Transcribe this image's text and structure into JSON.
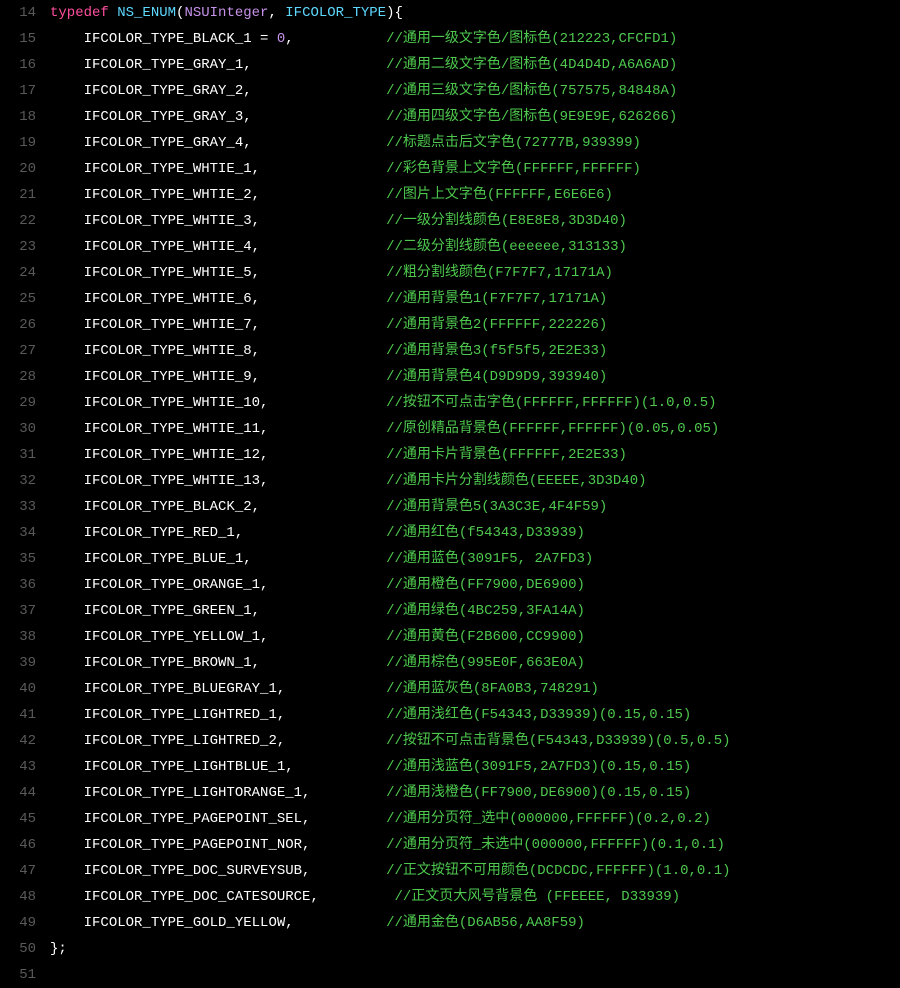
{
  "header": {
    "line_no": "14",
    "typedef": "typedef",
    "nsenum": "NS_ENUM",
    "uint": "NSUInteger",
    "enum_name": "IFCOLOR_TYPE",
    "open": "){"
  },
  "rows": [
    {
      "ln": "15",
      "name": "IFCOLOR_TYPE_BLACK_1 = ",
      "num": "0",
      "tail": ",",
      "comment": "//通用一级文字色/图标色(212223,CFCFD1)"
    },
    {
      "ln": "16",
      "name": "IFCOLOR_TYPE_GRAY_1,",
      "comment": "//通用二级文字色/图标色(4D4D4D,A6A6AD)"
    },
    {
      "ln": "17",
      "name": "IFCOLOR_TYPE_GRAY_2,",
      "comment": "//通用三级文字色/图标色(757575,84848A)"
    },
    {
      "ln": "18",
      "name": "IFCOLOR_TYPE_GRAY_3,",
      "comment": "//通用四级文字色/图标色(9E9E9E,626266)"
    },
    {
      "ln": "19",
      "name": "IFCOLOR_TYPE_GRAY_4,",
      "comment": "//标题点击后文字色(72777B,939399)"
    },
    {
      "ln": "20",
      "name": "IFCOLOR_TYPE_WHTIE_1,",
      "comment": "//彩色背景上文字色(FFFFFF,FFFFFF)"
    },
    {
      "ln": "21",
      "name": "IFCOLOR_TYPE_WHTIE_2,",
      "comment": "//图片上文字色(FFFFFF,E6E6E6)"
    },
    {
      "ln": "22",
      "name": "IFCOLOR_TYPE_WHTIE_3,",
      "comment": "//一级分割线颜色(E8E8E8,3D3D40)"
    },
    {
      "ln": "23",
      "name": "IFCOLOR_TYPE_WHTIE_4,",
      "comment": "//二级分割线颜色(eeeeee,313133)"
    },
    {
      "ln": "24",
      "name": "IFCOLOR_TYPE_WHTIE_5,",
      "comment": "//粗分割线颜色(F7F7F7,17171A)"
    },
    {
      "ln": "25",
      "name": "IFCOLOR_TYPE_WHTIE_6,",
      "comment": "//通用背景色1(F7F7F7,17171A)"
    },
    {
      "ln": "26",
      "name": "IFCOLOR_TYPE_WHTIE_7,",
      "comment": "//通用背景色2(FFFFFF,222226)"
    },
    {
      "ln": "27",
      "name": "IFCOLOR_TYPE_WHTIE_8,",
      "comment": "//通用背景色3(f5f5f5,2E2E33)"
    },
    {
      "ln": "28",
      "name": "IFCOLOR_TYPE_WHTIE_9,",
      "comment": "//通用背景色4(D9D9D9,393940)"
    },
    {
      "ln": "29",
      "name": "IFCOLOR_TYPE_WHTIE_10,",
      "comment": "//按钮不可点击字色(FFFFFF,FFFFFF)(1.0,0.5)"
    },
    {
      "ln": "30",
      "name": "IFCOLOR_TYPE_WHTIE_11,",
      "comment": "//原创精品背景色(FFFFFF,FFFFFF)(0.05,0.05)"
    },
    {
      "ln": "31",
      "name": "IFCOLOR_TYPE_WHTIE_12,",
      "comment": "//通用卡片背景色(FFFFFF,2E2E33)"
    },
    {
      "ln": "32",
      "name": "IFCOLOR_TYPE_WHTIE_13,",
      "comment": "//通用卡片分割线颜色(EEEEE,3D3D40)"
    },
    {
      "ln": "33",
      "name": "IFCOLOR_TYPE_BLACK_2,",
      "comment": "//通用背景色5(3A3C3E,4F4F59)"
    },
    {
      "ln": "34",
      "name": "IFCOLOR_TYPE_RED_1,",
      "comment": "//通用红色(f54343,D33939)"
    },
    {
      "ln": "35",
      "name": "IFCOLOR_TYPE_BLUE_1,",
      "comment": "//通用蓝色(3091F5, 2A7FD3)"
    },
    {
      "ln": "36",
      "name": "IFCOLOR_TYPE_ORANGE_1,",
      "comment": "//通用橙色(FF7900,DE6900)"
    },
    {
      "ln": "37",
      "name": "IFCOLOR_TYPE_GREEN_1,",
      "comment": "//通用绿色(4BC259,3FA14A)"
    },
    {
      "ln": "38",
      "name": "IFCOLOR_TYPE_YELLOW_1,",
      "comment": "//通用黄色(F2B600,CC9900)"
    },
    {
      "ln": "39",
      "name": "IFCOLOR_TYPE_BROWN_1,",
      "comment": "//通用棕色(995E0F,663E0A)"
    },
    {
      "ln": "40",
      "name": "IFCOLOR_TYPE_BLUEGRAY_1,",
      "comment": "//通用蓝灰色(8FA0B3,748291)"
    },
    {
      "ln": "41",
      "name": "IFCOLOR_TYPE_LIGHTRED_1,",
      "comment": "//通用浅红色(F54343,D33939)(0.15,0.15)"
    },
    {
      "ln": "42",
      "name": "IFCOLOR_TYPE_LIGHTRED_2,",
      "comment": "//按钮不可点击背景色(F54343,D33939)(0.5,0.5)"
    },
    {
      "ln": "43",
      "name": "IFCOLOR_TYPE_LIGHTBLUE_1,",
      "comment": "//通用浅蓝色(3091F5,2A7FD3)(0.15,0.15)"
    },
    {
      "ln": "44",
      "name": "IFCOLOR_TYPE_LIGHTORANGE_1,",
      "comment": "//通用浅橙色(FF7900,DE6900)(0.15,0.15)"
    },
    {
      "ln": "45",
      "name": "IFCOLOR_TYPE_PAGEPOINT_SEL,",
      "comment": "//通用分页符_选中(000000,FFFFFF)(0.2,0.2)"
    },
    {
      "ln": "46",
      "name": "IFCOLOR_TYPE_PAGEPOINT_NOR,",
      "comment": "//通用分页符_未选中(000000,FFFFFF)(0.1,0.1)"
    },
    {
      "ln": "47",
      "name": "IFCOLOR_TYPE_DOC_SURVEYSUB,",
      "comment": "//正文按钮不可用颜色(DCDCDC,FFFFFF)(1.0,0.1)"
    },
    {
      "ln": "48",
      "name": "IFCOLOR_TYPE_DOC_CATESOURCE,",
      "comment": " //正文页大风号背景色 (FFEEEE, D33939)"
    },
    {
      "ln": "49",
      "name": "IFCOLOR_TYPE_GOLD_YELLOW,",
      "comment": "//通用金色(D6AB56,AA8F59)"
    }
  ],
  "footer": {
    "ln_close": "50",
    "close": "};",
    "ln_blank": "51"
  },
  "name_col_width": 36
}
